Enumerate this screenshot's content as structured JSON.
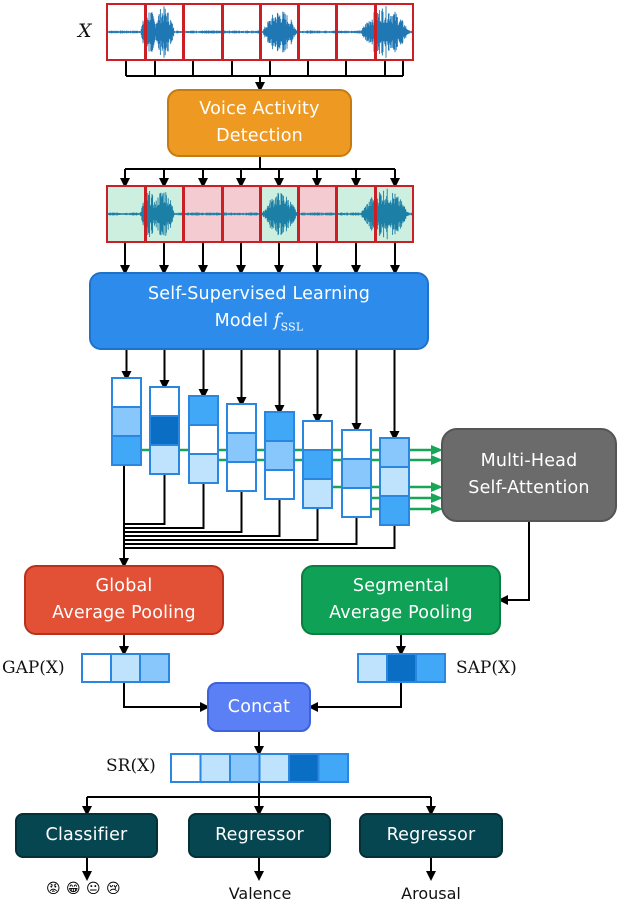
{
  "input_label": "X",
  "vad": {
    "line1": "Voice Activity",
    "line2": "Detection",
    "color": "#EE9A22"
  },
  "ssl": {
    "line1": "Self-Supervised Learning",
    "line2": "Model ",
    "symbol": "f",
    "subscript": "SSL",
    "color": "#2D8CEB"
  },
  "mhsa": {
    "line1": "Multi-Head",
    "line2": "Self-Attention",
    "color": "#6B6B6B"
  },
  "gap": {
    "line1": "Global",
    "line2": "Average Pooling",
    "color": "#E25035",
    "vector_label": "GAP(X)",
    "cells": [
      0,
      1,
      2
    ]
  },
  "sap": {
    "line1": "Segmental",
    "line2": "Average Pooling",
    "color": "#0FA155",
    "vector_label": "SAP(X)",
    "cells": [
      1,
      4,
      3
    ]
  },
  "concat": {
    "label": "Concat",
    "color": "#5B7FF5"
  },
  "sr": {
    "vector_label": "SR(X)",
    "cells": [
      0,
      1,
      2,
      1,
      4,
      3
    ]
  },
  "heads": [
    {
      "label": "Classifier",
      "output": "emotions",
      "emojis": [
        "😡",
        "😁",
        "😐",
        "😢"
      ]
    },
    {
      "label": "Regressor",
      "output": "Valence"
    },
    {
      "label": "Regressor",
      "output": "Arousal"
    }
  ],
  "head_color": "#064650",
  "segments": {
    "count": 8,
    "vad_speech": [
      true,
      true,
      false,
      false,
      true,
      false,
      true,
      true
    ],
    "speech_color": "#CDEFDF",
    "silence_color": "#F3CBD1",
    "frame_color": "#CC1F25",
    "wave_color": "#1F77B4"
  },
  "frame_vectors": [
    [
      0,
      2,
      3
    ],
    [
      0,
      4,
      1
    ],
    [
      3,
      0,
      1
    ],
    [
      0,
      2,
      0
    ],
    [
      3,
      2,
      0
    ],
    [
      0,
      3,
      1
    ],
    [
      0,
      2,
      0
    ],
    [
      2,
      1,
      3
    ]
  ],
  "cell_palette": [
    "#FFFFFF",
    "#BFE2FD",
    "#87C7FC",
    "#41A8F8",
    "#0A6FC4"
  ],
  "attention_color": "#18A558"
}
